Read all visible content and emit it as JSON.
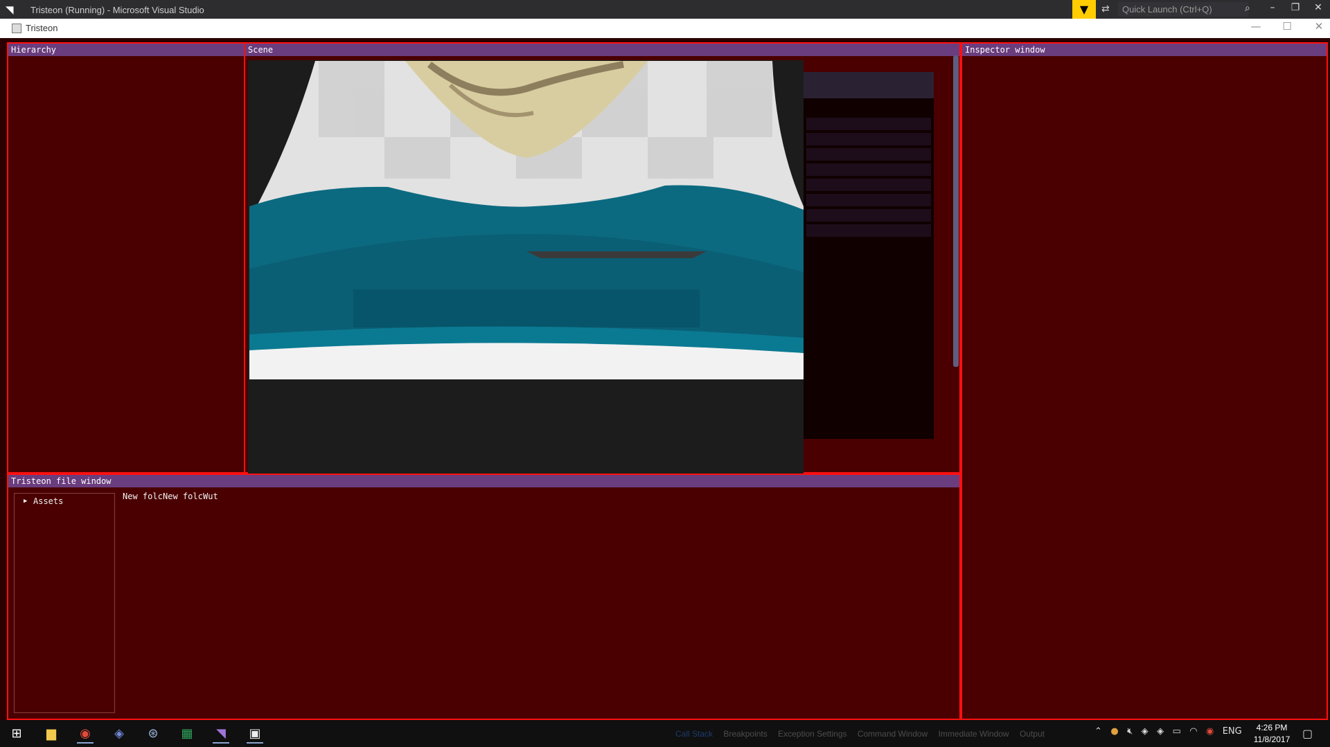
{
  "vs_window": {
    "title": "Tristeon (Running) - Microsoft Visual Studio",
    "logo_glyph": "◥",
    "filter_glyph": "▼",
    "feedback_glyph": "⇄",
    "quick_launch_placeholder": "Quick Launch (Ctrl+Q)",
    "search_glyph": "⌕",
    "min_glyph": "–",
    "restore_glyph": "❐",
    "close_glyph": "✕"
  },
  "app_window": {
    "title": "Tristeon",
    "min_glyph": "—",
    "max_glyph": "☐",
    "close_glyph": "✕"
  },
  "panels": {
    "hierarchy": "Hierarchy",
    "scene": "Scene",
    "inspector": "Inspector window",
    "file_window": "Tristeon file window"
  },
  "file_window": {
    "tree_arrow": "▶",
    "tree_root": "Assets",
    "folder_items": [
      "New folc",
      "New folc",
      "Wut"
    ]
  },
  "vs_bottom_tabs": [
    "Call Stack",
    "Breakpoints",
    "Exception Settings",
    "Command Window",
    "Immediate Window",
    "Output"
  ],
  "tray": {
    "language": "ENG",
    "time": "4:26 PM",
    "date": "11/8/2017"
  },
  "colors": {
    "panel_bg": "#4a0000",
    "panel_border": "#ff1010",
    "panel_header": "#6a3d7e",
    "teal": "#0c6a80"
  }
}
